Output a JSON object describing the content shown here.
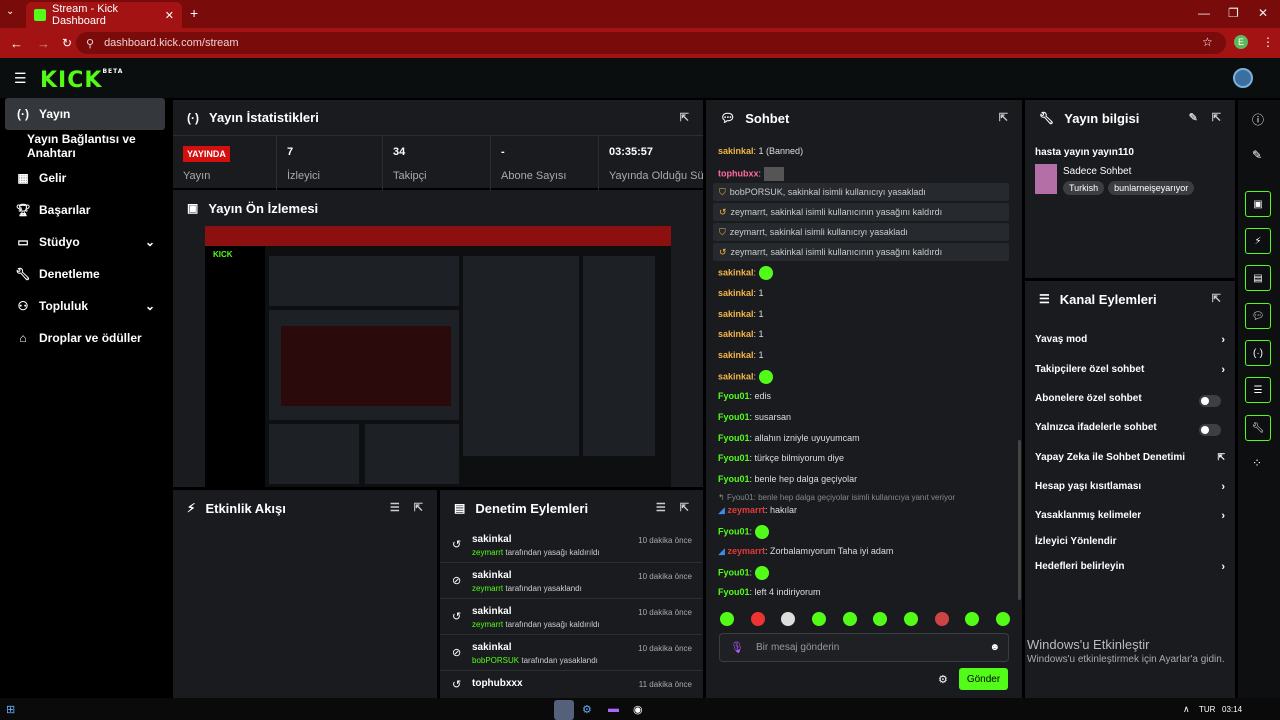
{
  "browser": {
    "tab_title": "Stream - Kick Dashboard",
    "url": "dashboard.kick.com/stream",
    "profile": "E"
  },
  "logo": {
    "text": "KICK",
    "beta": "BETA"
  },
  "sidebar": {
    "items": [
      {
        "label": "Yayın",
        "icon": "broadcast-icon"
      },
      {
        "label": "Yayın Bağlantısı ve Anahtarı",
        "icon": ""
      },
      {
        "label": "Gelir",
        "icon": "revenue-icon"
      },
      {
        "label": "Başarılar",
        "icon": "trophy-icon"
      },
      {
        "label": "Stüdyo",
        "icon": "studio-icon"
      },
      {
        "label": "Denetleme",
        "icon": "wrench-icon"
      },
      {
        "label": "Topluluk",
        "icon": "community-icon"
      },
      {
        "label": "Droplar ve ödüller",
        "icon": "gift-icon"
      }
    ]
  },
  "stats": {
    "title": "Yayın İstatistikleri",
    "live": "YAYINDA",
    "live_label": "Yayın",
    "items": [
      {
        "value": "7",
        "label": "İzleyici"
      },
      {
        "value": "34",
        "label": "Takipçi"
      },
      {
        "value": "-",
        "label": "Abone Sayısı"
      },
      {
        "value": "03:35:57",
        "label": "Yayında Olduğu Süre"
      }
    ]
  },
  "preview": {
    "title": "Yayın Ön İzlemesi"
  },
  "activity": {
    "title": "Etkinlik Akışı"
  },
  "audit": {
    "title": "Denetim Eylemleri",
    "rows": [
      {
        "user": "sakinkal",
        "actor": "zeymarrt",
        "action": "tarafından yasağı kaldırıldı",
        "time": "10 dakika önce"
      },
      {
        "user": "sakinkal",
        "actor": "zeymarrt",
        "action": "tarafından yasaklandı",
        "time": "10 dakika önce"
      },
      {
        "user": "sakinkal",
        "actor": "zeymarrt",
        "action": "tarafından yasağı kaldırıldı",
        "time": "10 dakika önce"
      },
      {
        "user": "sakinkal",
        "actor": "bobPORSUK",
        "action": "tarafından yasaklandı",
        "time": "10 dakika önce"
      },
      {
        "user": "tophubxxx",
        "actor": "",
        "action": "",
        "time": "11 dakika önce"
      }
    ]
  },
  "chat": {
    "title": "Sohbet",
    "top_user": "sakinkal",
    "top_text": ": 1 (Banned)",
    "second_user": "tophubxx",
    "mod": [
      {
        "text": "bobPORSUK, sakinkal isimli kullanıcıyı yasakladı"
      },
      {
        "text": "zeymarrt, sakinkal isimli kullanıcının yasağını kaldırdı"
      },
      {
        "text": "zeymarrt, sakinkal isimli kullanıcıyı yasakladı"
      },
      {
        "text": "zeymarrt, sakinkal isimli kullanıcının yasağını kaldırdı"
      }
    ],
    "msgs": [
      {
        "user": "sakinkal",
        "text": "",
        "emote": true
      },
      {
        "user": "sakinkal",
        "text": "1"
      },
      {
        "user": "sakinkal",
        "text": "1"
      },
      {
        "user": "sakinkal",
        "text": "1"
      },
      {
        "user": "sakinkal",
        "text": "1"
      },
      {
        "user": "sakinkal",
        "text": "",
        "emote": true
      },
      {
        "user": "Fyou01",
        "text": "edis"
      },
      {
        "user": "Fyou01",
        "text": "susarsan"
      },
      {
        "user": "Fyou01",
        "text": "allahın izniyle uyuyumcam"
      },
      {
        "user": "Fyou01",
        "text": "türkçe bilmiyorum diye"
      },
      {
        "user": "Fyou01",
        "text": "benle hep dalga geçiyolar"
      }
    ],
    "reply_note": "Fyou01: benle hep dalga geçiyolar isimli kullanıcıya yanıt veriyor",
    "msgs2": [
      {
        "user": "zeymarrt",
        "text": "hakılar"
      },
      {
        "user": "Fyou01",
        "text": "",
        "emote": true
      },
      {
        "user": "zeymarrt",
        "text": "Zorbalamıyorum Taha iyi adam"
      },
      {
        "user": "Fyou01",
        "text": "",
        "emote": true
      },
      {
        "user": "Fyou01",
        "text": "left 4 indiriyorum"
      }
    ],
    "input_placeholder": "Bir mesaj gönderin",
    "send": "Gönder"
  },
  "info": {
    "title": "Yayın bilgisi",
    "stream_title": "hasta yayın yayın110",
    "category": "Sadece Sohbet",
    "tags": [
      "Turkish",
      "bunlarneişeyarıyor"
    ]
  },
  "channel_actions": {
    "title": "Kanal Eylemleri",
    "items": [
      {
        "label": "Yavaş mod",
        "kind": "chevron"
      },
      {
        "label": "Takipçilere özel sohbet",
        "kind": "chevron"
      },
      {
        "label": "Abonelere özel sohbet",
        "kind": "toggle"
      },
      {
        "label": "Yalnızca ifadelerle sohbet",
        "kind": "toggle"
      },
      {
        "label": "Yapay Zeka ile Sohbet Denetimi",
        "kind": "external"
      },
      {
        "label": "Hesap yaşı kısıtlaması",
        "kind": "chevron"
      },
      {
        "label": "Yasaklanmış kelimeler",
        "kind": "chevron"
      },
      {
        "label": "İzleyici Yönlendir",
        "kind": "none"
      },
      {
        "label": "Hedefleri belirleyin",
        "kind": "chevron"
      }
    ]
  },
  "windows": {
    "activate_title": "Windows'u Etkinleştir",
    "activate_sub": "Windows'u etkinleştirmek için Ayarlar'a gidin.",
    "lang": "TUR",
    "time": "03:14"
  }
}
